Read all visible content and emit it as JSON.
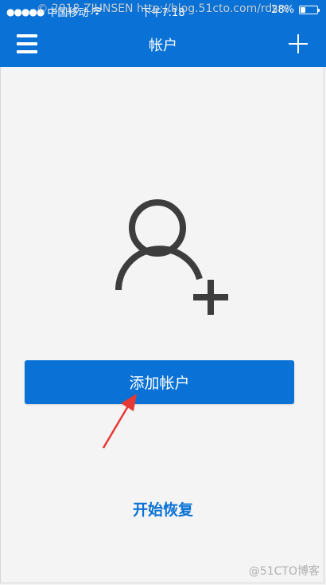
{
  "watermark": {
    "top": "© 2018 ZJUNSEN http://blog.51cto.com/rdsrv",
    "bottom": "@51CTO博客"
  },
  "status_bar": {
    "signal": "●●●●●",
    "carrier": "中国移动",
    "wifi_icon": "wifi-icon",
    "time": "下午7:18",
    "battery_percent": "28%",
    "battery_level": 0.28
  },
  "nav": {
    "menu_icon": "hamburger-icon",
    "title": "帐户",
    "add_icon": "plus-icon"
  },
  "main": {
    "illustration_icon": "add-user-icon",
    "add_account_label": "添加帐户",
    "start_restore_label": "开始恢复"
  },
  "colors": {
    "accent": "#0a72d6",
    "annotation_arrow": "#e53935"
  }
}
